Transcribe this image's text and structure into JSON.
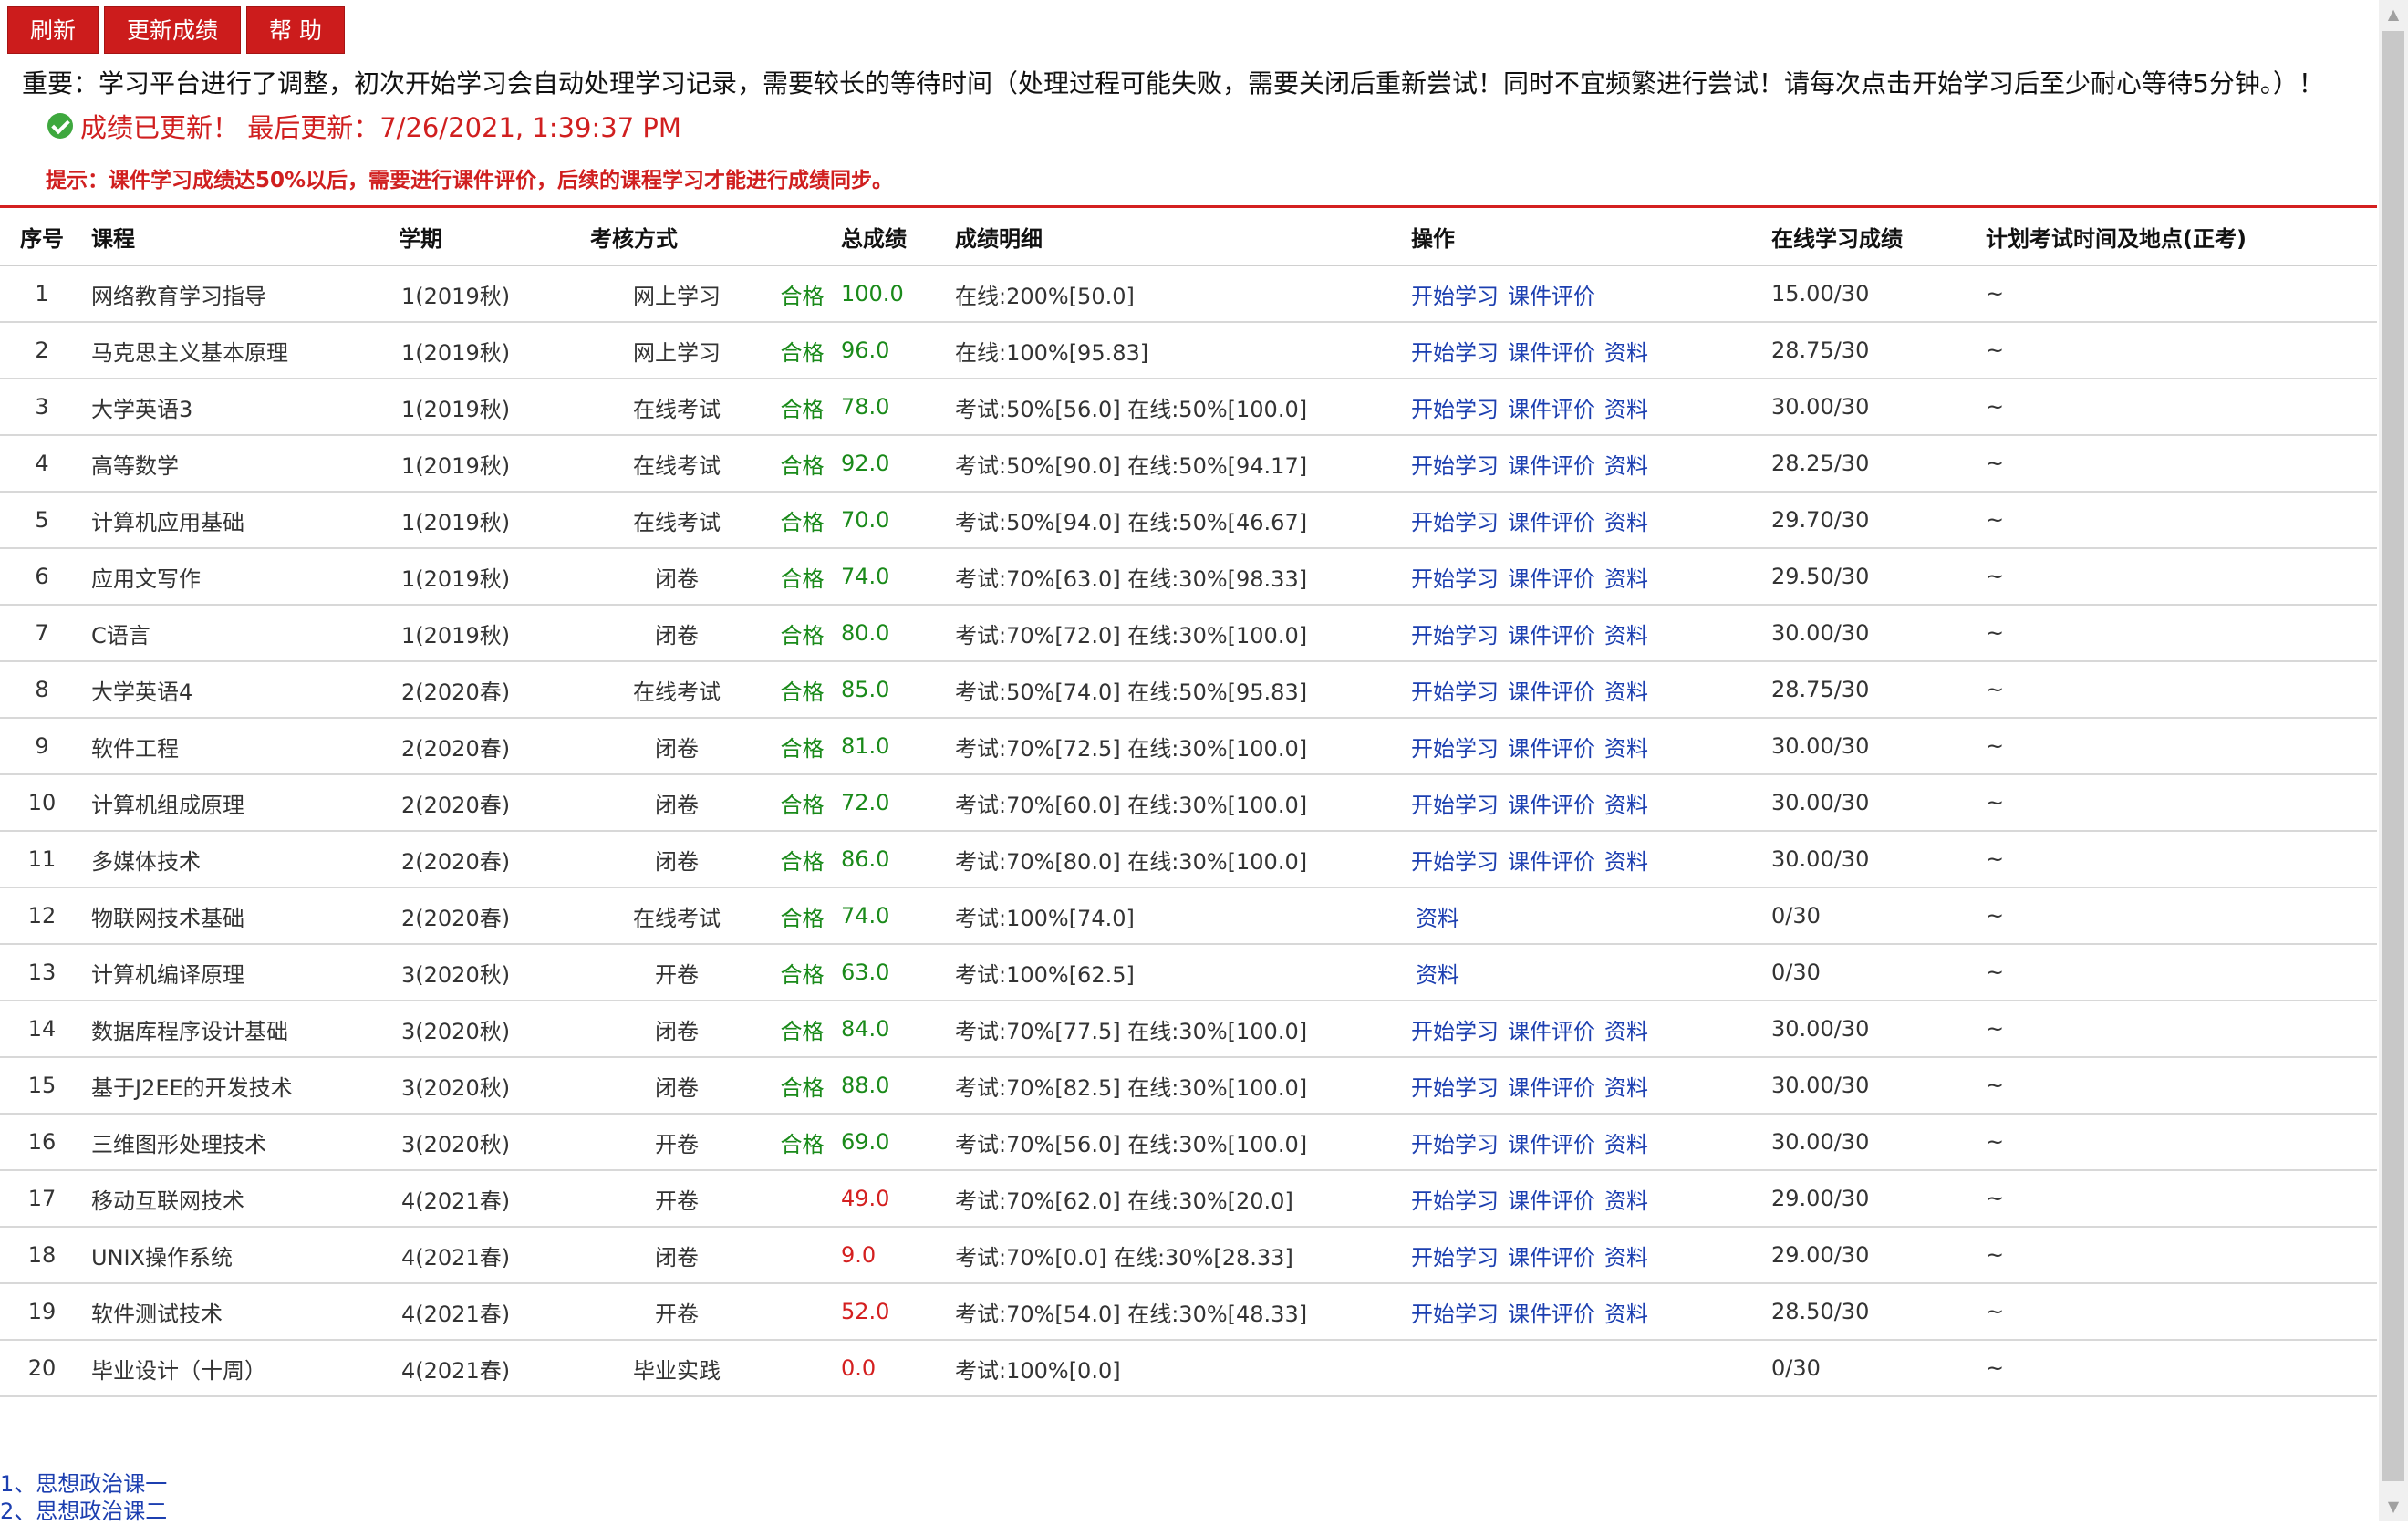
{
  "toolbar": {
    "refresh": "刷新",
    "update_scores": "更新成绩",
    "help": "帮 助"
  },
  "notice": "重要：学习平台进行了调整，初次开始学习会自动处理学习记录，需要较长的等待时间（处理过程可能失败，需要关闭后重新尝试！同时不宜频繁进行尝试！请每次点击开始学习后至少耐心等待5分钟。）！",
  "status": {
    "text": "成绩已更新！ 最后更新：7/26/2021, 1:39:37 PM",
    "icon": "check-circle-icon"
  },
  "tip": "提示：课件学习成绩达50%以后，需要进行课件评价，后续的课程学习才能进行成绩同步。",
  "colors": {
    "accent_red": "#cc1c1c",
    "pass_green": "#1a8a1a",
    "fail_red": "#d42020",
    "link_blue": "#1c3fb0"
  },
  "table": {
    "headers": [
      "序号",
      "课程",
      "学期",
      "考核方式",
      "",
      "总成绩",
      "成绩明细",
      "操作",
      "在线学习成绩",
      "计划考试时间及地点(正考)"
    ],
    "action_labels": {
      "start": "开始学习",
      "evaluate": "课件评价",
      "materials": "资料"
    },
    "rows": [
      {
        "idx": "1",
        "course": "网络教育学习指导",
        "term": "1(2019秋)",
        "method": "网上学习",
        "pass": "合格",
        "total": "100.0",
        "total_status": "pass",
        "detail": "在线:200%[50.0]",
        "actions": [
          "start",
          "evaluate"
        ],
        "online": "15.00/30",
        "exam": "~"
      },
      {
        "idx": "2",
        "course": "马克思主义基本原理",
        "term": "1(2019秋)",
        "method": "网上学习",
        "pass": "合格",
        "total": "96.0",
        "total_status": "pass",
        "detail": "在线:100%[95.83]",
        "actions": [
          "start",
          "evaluate",
          "materials"
        ],
        "online": "28.75/30",
        "exam": "~"
      },
      {
        "idx": "3",
        "course": "大学英语3",
        "term": "1(2019秋)",
        "method": "在线考试",
        "pass": "合格",
        "total": "78.0",
        "total_status": "pass",
        "detail": "考试:50%[56.0] 在线:50%[100.0]",
        "actions": [
          "start",
          "evaluate",
          "materials"
        ],
        "online": "30.00/30",
        "exam": "~"
      },
      {
        "idx": "4",
        "course": "高等数学",
        "term": "1(2019秋)",
        "method": "在线考试",
        "pass": "合格",
        "total": "92.0",
        "total_status": "pass",
        "detail": "考试:50%[90.0] 在线:50%[94.17]",
        "actions": [
          "start",
          "evaluate",
          "materials"
        ],
        "online": "28.25/30",
        "exam": "~"
      },
      {
        "idx": "5",
        "course": "计算机应用基础",
        "term": "1(2019秋)",
        "method": "在线考试",
        "pass": "合格",
        "total": "70.0",
        "total_status": "pass",
        "detail": "考试:50%[94.0] 在线:50%[46.67]",
        "actions": [
          "start",
          "evaluate",
          "materials"
        ],
        "online": "29.70/30",
        "exam": "~"
      },
      {
        "idx": "6",
        "course": "应用文写作",
        "term": "1(2019秋)",
        "method": "闭卷",
        "pass": "合格",
        "total": "74.0",
        "total_status": "pass",
        "detail": "考试:70%[63.0] 在线:30%[98.33]",
        "actions": [
          "start",
          "evaluate",
          "materials"
        ],
        "online": "29.50/30",
        "exam": "~"
      },
      {
        "idx": "7",
        "course": "C语言",
        "term": "1(2019秋)",
        "method": "闭卷",
        "pass": "合格",
        "total": "80.0",
        "total_status": "pass",
        "detail": "考试:70%[72.0] 在线:30%[100.0]",
        "actions": [
          "start",
          "evaluate",
          "materials"
        ],
        "online": "30.00/30",
        "exam": "~"
      },
      {
        "idx": "8",
        "course": "大学英语4",
        "term": "2(2020春)",
        "method": "在线考试",
        "pass": "合格",
        "total": "85.0",
        "total_status": "pass",
        "detail": "考试:50%[74.0] 在线:50%[95.83]",
        "actions": [
          "start",
          "evaluate",
          "materials"
        ],
        "online": "28.75/30",
        "exam": "~"
      },
      {
        "idx": "9",
        "course": "软件工程",
        "term": "2(2020春)",
        "method": "闭卷",
        "pass": "合格",
        "total": "81.0",
        "total_status": "pass",
        "detail": "考试:70%[72.5] 在线:30%[100.0]",
        "actions": [
          "start",
          "evaluate",
          "materials"
        ],
        "online": "30.00/30",
        "exam": "~"
      },
      {
        "idx": "10",
        "course": "计算机组成原理",
        "term": "2(2020春)",
        "method": "闭卷",
        "pass": "合格",
        "total": "72.0",
        "total_status": "pass",
        "detail": "考试:70%[60.0] 在线:30%[100.0]",
        "actions": [
          "start",
          "evaluate",
          "materials"
        ],
        "online": "30.00/30",
        "exam": "~"
      },
      {
        "idx": "11",
        "course": "多媒体技术",
        "term": "2(2020春)",
        "method": "闭卷",
        "pass": "合格",
        "total": "86.0",
        "total_status": "pass",
        "detail": "考试:70%[80.0] 在线:30%[100.0]",
        "actions": [
          "start",
          "evaluate",
          "materials"
        ],
        "online": "30.00/30",
        "exam": "~"
      },
      {
        "idx": "12",
        "course": "物联网技术基础",
        "term": "2(2020春)",
        "method": "在线考试",
        "pass": "合格",
        "total": "74.0",
        "total_status": "pass",
        "detail": "考试:100%[74.0]",
        "actions": [
          "materials"
        ],
        "online": "0/30",
        "exam": "~"
      },
      {
        "idx": "13",
        "course": "计算机编译原理",
        "term": "3(2020秋)",
        "method": "开卷",
        "pass": "合格",
        "total": "63.0",
        "total_status": "pass",
        "detail": "考试:100%[62.5]",
        "actions": [
          "materials"
        ],
        "online": "0/30",
        "exam": "~"
      },
      {
        "idx": "14",
        "course": "数据库程序设计基础",
        "term": "3(2020秋)",
        "method": "闭卷",
        "pass": "合格",
        "total": "84.0",
        "total_status": "pass",
        "detail": "考试:70%[77.5] 在线:30%[100.0]",
        "actions": [
          "start",
          "evaluate",
          "materials"
        ],
        "online": "30.00/30",
        "exam": "~"
      },
      {
        "idx": "15",
        "course": "基于J2EE的开发技术",
        "term": "3(2020秋)",
        "method": "闭卷",
        "pass": "合格",
        "total": "88.0",
        "total_status": "pass",
        "detail": "考试:70%[82.5] 在线:30%[100.0]",
        "actions": [
          "start",
          "evaluate",
          "materials"
        ],
        "online": "30.00/30",
        "exam": "~"
      },
      {
        "idx": "16",
        "course": "三维图形处理技术",
        "term": "3(2020秋)",
        "method": "开卷",
        "pass": "合格",
        "total": "69.0",
        "total_status": "pass",
        "detail": "考试:70%[56.0] 在线:30%[100.0]",
        "actions": [
          "start",
          "evaluate",
          "materials"
        ],
        "online": "30.00/30",
        "exam": "~"
      },
      {
        "idx": "17",
        "course": "移动互联网技术",
        "term": "4(2021春)",
        "method": "开卷",
        "pass": "",
        "total": "49.0",
        "total_status": "fail",
        "detail": "考试:70%[62.0] 在线:30%[20.0]",
        "actions": [
          "start",
          "evaluate",
          "materials"
        ],
        "online": "29.00/30",
        "exam": "~"
      },
      {
        "idx": "18",
        "course": "UNIX操作系统",
        "term": "4(2021春)",
        "method": "闭卷",
        "pass": "",
        "total": "9.0",
        "total_status": "fail",
        "detail": "考试:70%[0.0] 在线:30%[28.33]",
        "actions": [
          "start",
          "evaluate",
          "materials"
        ],
        "online": "29.00/30",
        "exam": "~"
      },
      {
        "idx": "19",
        "course": "软件测试技术",
        "term": "4(2021春)",
        "method": "开卷",
        "pass": "",
        "total": "52.0",
        "total_status": "fail",
        "detail": "考试:70%[54.0] 在线:30%[48.33]",
        "actions": [
          "start",
          "evaluate",
          "materials"
        ],
        "online": "28.50/30",
        "exam": "~"
      },
      {
        "idx": "20",
        "course": "毕业设计（十周）",
        "term": "4(2021春)",
        "method": "毕业实践",
        "pass": "",
        "total": "0.0",
        "total_status": "fail",
        "detail": "考试:100%[0.0]",
        "actions": [],
        "online": "0/30",
        "exam": "~"
      }
    ]
  },
  "bottom_links": [
    "1、思想政治课一",
    "2、思想政治课二"
  ]
}
